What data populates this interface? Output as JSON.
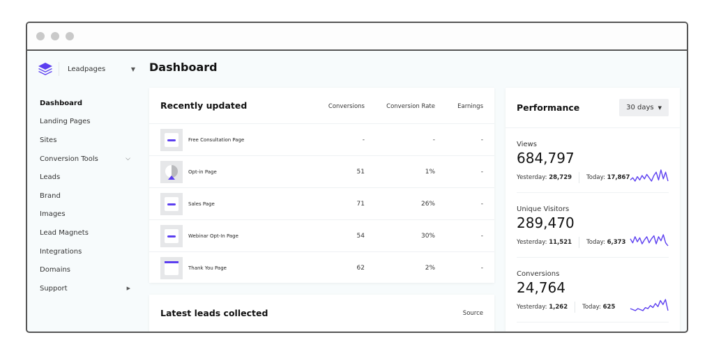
{
  "window": {
    "dots": [
      "close",
      "minimize",
      "maximize"
    ]
  },
  "brand": {
    "name": "Leadpages",
    "logo_color": "#5b3ef0"
  },
  "header": {
    "title": "Dashboard"
  },
  "sidebar": {
    "items": [
      {
        "label": "Dashboard",
        "active": true
      },
      {
        "label": "Landing Pages"
      },
      {
        "label": "Sites"
      },
      {
        "label": "Conversion Tools",
        "chevron": "down"
      },
      {
        "label": "Leads"
      },
      {
        "label": "Brand"
      },
      {
        "label": "Images"
      },
      {
        "label": "Lead Magnets"
      },
      {
        "label": "Integrations"
      },
      {
        "label": "Domains"
      },
      {
        "label": "Support",
        "chevron": "right"
      }
    ]
  },
  "recent": {
    "title": "Recently updated",
    "columns": {
      "conversions": "Conversions",
      "rate": "Conversion Rate",
      "earnings": "Earnings"
    },
    "rows": [
      {
        "name": "Free Consultation Page",
        "thumb": "bar",
        "conversions": "-",
        "rate": "-",
        "earnings": "-"
      },
      {
        "name": "Opt-in Page",
        "thumb": "optin",
        "conversions": "51",
        "rate": "1%",
        "earnings": "-"
      },
      {
        "name": "Sales Page",
        "thumb": "bar",
        "conversions": "71",
        "rate": "26%",
        "earnings": "-"
      },
      {
        "name": "Webinar Opt-In Page",
        "thumb": "bar",
        "conversions": "54",
        "rate": "30%",
        "earnings": "-"
      },
      {
        "name": "Thank You Page",
        "thumb": "topbar",
        "conversions": "62",
        "rate": "2%",
        "earnings": "-"
      }
    ]
  },
  "leads": {
    "title": "Latest leads collected",
    "source_label": "Source"
  },
  "performance": {
    "title": "Performance",
    "range": "30 days",
    "accent": "#5b3ef0",
    "metrics": [
      {
        "label": "Views",
        "value": "684,797",
        "yesterday_label": "Yesterday:",
        "yesterday": "28,729",
        "today_label": "Today:",
        "today": "17,867",
        "spark": [
          5,
          7,
          4,
          8,
          5,
          9,
          6,
          10,
          7,
          4,
          9,
          12,
          5,
          14,
          6,
          12,
          4
        ]
      },
      {
        "label": "Unique Visitors",
        "value": "289,470",
        "yesterday_label": "Yesterday:",
        "yesterday": "11,521",
        "today_label": "Today:",
        "today": "6,373",
        "spark": [
          10,
          6,
          12,
          7,
          11,
          5,
          9,
          12,
          6,
          10,
          13,
          5,
          12,
          8,
          14,
          6,
          3
        ]
      },
      {
        "label": "Conversions",
        "value": "24,764",
        "yesterday_label": "Yesterday:",
        "yesterday": "1,262",
        "today_label": "Today:",
        "today": "625",
        "spark": [
          5,
          4,
          3,
          5,
          4,
          3,
          6,
          5,
          8,
          6,
          10,
          7,
          13,
          9,
          14,
          3
        ]
      }
    ]
  }
}
